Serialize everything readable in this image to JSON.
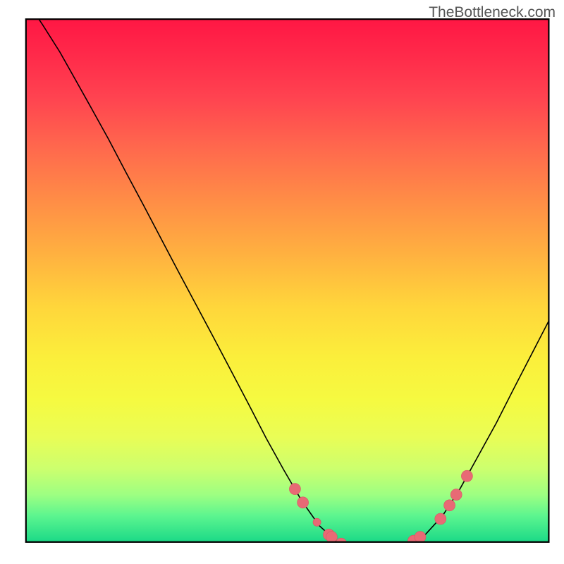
{
  "watermark": "TheBottleneck.com",
  "chart_data": {
    "type": "line",
    "title": "",
    "xlabel": "",
    "ylabel": "",
    "xlim": [
      0,
      100
    ],
    "ylim": [
      0,
      100
    ],
    "curve": {
      "name": "bottleneck-curve",
      "points": [
        {
          "x": 4.6,
          "y": 100.0
        },
        {
          "x": 7.5,
          "y": 95.7
        },
        {
          "x": 10.6,
          "y": 90.8
        },
        {
          "x": 13.3,
          "y": 86.0
        },
        {
          "x": 16.1,
          "y": 81.0
        },
        {
          "x": 19.2,
          "y": 75.4
        },
        {
          "x": 22.3,
          "y": 69.5
        },
        {
          "x": 25.4,
          "y": 63.7
        },
        {
          "x": 28.5,
          "y": 57.8
        },
        {
          "x": 31.6,
          "y": 51.9
        },
        {
          "x": 34.7,
          "y": 46.1
        },
        {
          "x": 37.9,
          "y": 40.1
        },
        {
          "x": 41.0,
          "y": 34.2
        },
        {
          "x": 44.1,
          "y": 28.3
        },
        {
          "x": 47.2,
          "y": 22.3
        },
        {
          "x": 50.3,
          "y": 16.7
        },
        {
          "x": 53.5,
          "y": 11.2
        },
        {
          "x": 56.6,
          "y": 6.8
        },
        {
          "x": 59.7,
          "y": 4.0
        },
        {
          "x": 62.8,
          "y": 2.8
        },
        {
          "x": 66.0,
          "y": 2.5
        },
        {
          "x": 69.1,
          "y": 2.6
        },
        {
          "x": 72.2,
          "y": 3.5
        },
        {
          "x": 75.4,
          "y": 5.2
        },
        {
          "x": 78.5,
          "y": 8.6
        },
        {
          "x": 81.6,
          "y": 13.4
        },
        {
          "x": 84.7,
          "y": 19.0
        },
        {
          "x": 88.0,
          "y": 25.0
        },
        {
          "x": 91.1,
          "y": 31.1
        },
        {
          "x": 94.2,
          "y": 37.1
        },
        {
          "x": 97.3,
          "y": 43.1
        },
        {
          "x": 100.0,
          "y": 48.2
        }
      ]
    },
    "markers": [
      {
        "x": 52.3,
        "y": 13.3,
        "r": 1.0
      },
      {
        "x": 53.7,
        "y": 10.9,
        "r": 1.0
      },
      {
        "x": 56.2,
        "y": 7.4,
        "r": 0.7
      },
      {
        "x": 58.3,
        "y": 5.2,
        "r": 1.0
      },
      {
        "x": 58.8,
        "y": 4.8,
        "r": 1.0
      },
      {
        "x": 60.5,
        "y": 3.6,
        "r": 1.0
      },
      {
        "x": 62.9,
        "y": 2.8,
        "r": 1.0
      },
      {
        "x": 64.3,
        "y": 2.6,
        "r": 1.0
      },
      {
        "x": 66.5,
        "y": 2.5,
        "r": 1.0
      },
      {
        "x": 68.0,
        "y": 2.5,
        "r": 1.0
      },
      {
        "x": 70.9,
        "y": 2.9,
        "r": 1.0
      },
      {
        "x": 73.3,
        "y": 4.1,
        "r": 1.0
      },
      {
        "x": 74.5,
        "y": 4.8,
        "r": 1.0
      },
      {
        "x": 78.1,
        "y": 8.0,
        "r": 1.0
      },
      {
        "x": 79.7,
        "y": 10.4,
        "r": 1.0
      },
      {
        "x": 80.9,
        "y": 12.3,
        "r": 1.0
      },
      {
        "x": 82.8,
        "y": 15.6,
        "r": 1.0
      }
    ],
    "frame": {
      "x0": 4.6,
      "y0": 3.9,
      "x1": 97.3,
      "y1": 96.6
    },
    "gradient_stops": [
      {
        "offset": 0.0,
        "color": "#ff1744"
      },
      {
        "offset": 0.07,
        "color": "#ff2a4a"
      },
      {
        "offset": 0.15,
        "color": "#ff4350"
      },
      {
        "offset": 0.25,
        "color": "#ff6a4d"
      },
      {
        "offset": 0.35,
        "color": "#ff8e46"
      },
      {
        "offset": 0.45,
        "color": "#ffb140"
      },
      {
        "offset": 0.55,
        "color": "#ffd63b"
      },
      {
        "offset": 0.65,
        "color": "#fbef3b"
      },
      {
        "offset": 0.73,
        "color": "#f5fa41"
      },
      {
        "offset": 0.8,
        "color": "#e9fd56"
      },
      {
        "offset": 0.86,
        "color": "#ccff6e"
      },
      {
        "offset": 0.91,
        "color": "#9dff82"
      },
      {
        "offset": 0.95,
        "color": "#5cf58f"
      },
      {
        "offset": 1.0,
        "color": "#1bd987"
      }
    ],
    "colors": {
      "frame": "#000000",
      "curve": "#000000",
      "marker_fill": "#e86a75",
      "marker_stroke": "#d85562"
    }
  }
}
